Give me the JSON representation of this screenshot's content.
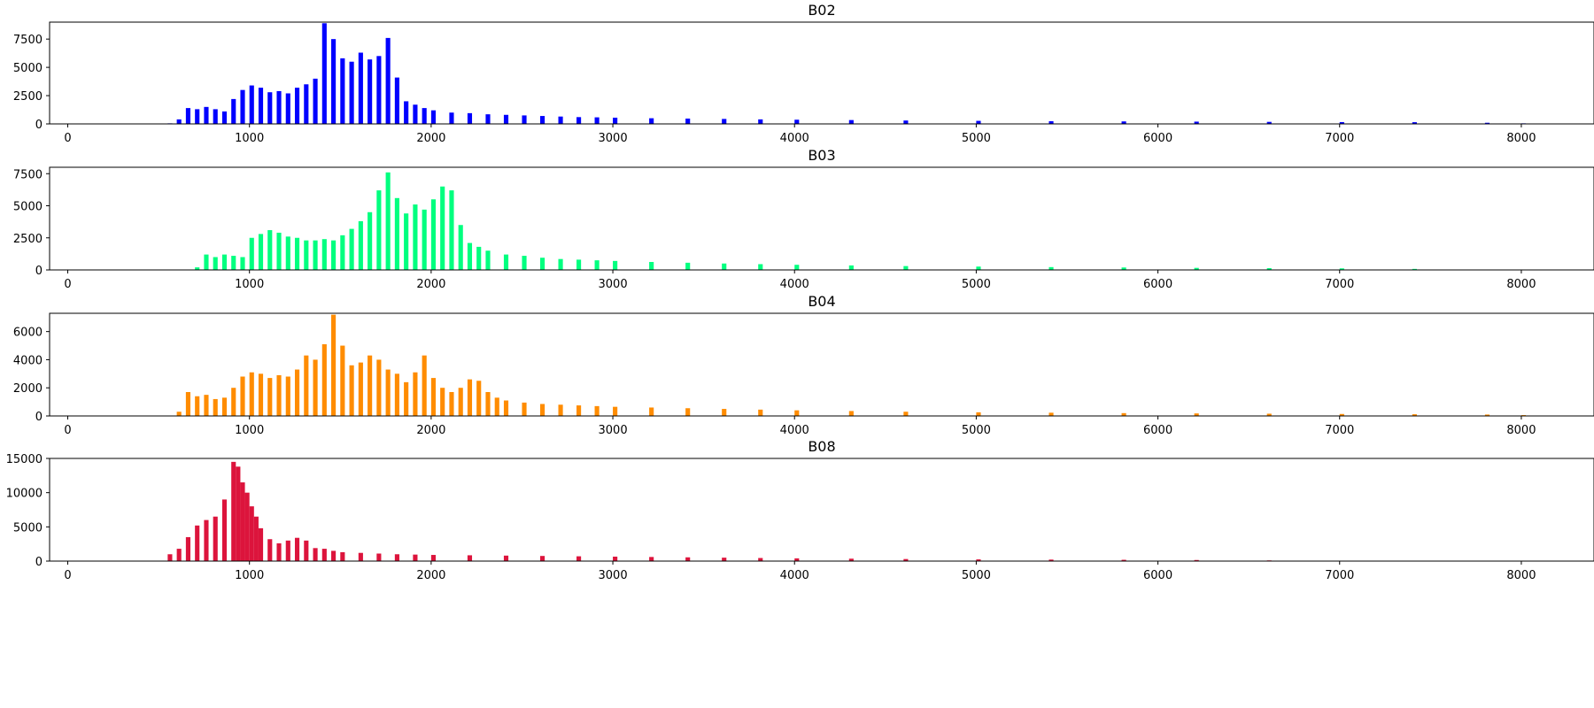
{
  "chart_data": [
    {
      "type": "bar",
      "title": "B02",
      "color": "#0000ff",
      "xlim": [
        -100,
        8400
      ],
      "ylim": [
        0,
        9000
      ],
      "xticks": [
        0,
        1000,
        2000,
        3000,
        4000,
        5000,
        6000,
        7000,
        8000
      ],
      "yticks": [
        0,
        2500,
        5000,
        7500
      ],
      "bin_width": 25,
      "x": [
        550,
        600,
        650,
        700,
        750,
        800,
        850,
        900,
        950,
        1000,
        1050,
        1100,
        1150,
        1200,
        1250,
        1300,
        1350,
        1400,
        1450,
        1500,
        1550,
        1600,
        1650,
        1700,
        1750,
        1800,
        1850,
        1900,
        1950,
        2000,
        2100,
        2200,
        2300,
        2400,
        2500,
        2600,
        2700,
        2800,
        2900,
        3000,
        3200,
        3400,
        3600,
        3800,
        4000,
        4300,
        4600,
        5000,
        5400,
        5800,
        6200,
        6600,
        7000,
        7400,
        7800,
        8000
      ],
      "values": [
        50,
        400,
        1400,
        1300,
        1500,
        1300,
        1100,
        2200,
        3000,
        3400,
        3200,
        2800,
        2900,
        2700,
        3200,
        3500,
        4000,
        8900,
        7500,
        5800,
        5500,
        6300,
        5700,
        6000,
        7600,
        4100,
        2000,
        1700,
        1400,
        1200,
        1000,
        950,
        850,
        800,
        750,
        700,
        650,
        600,
        580,
        550,
        500,
        470,
        440,
        400,
        370,
        340,
        300,
        270,
        240,
        220,
        200,
        180,
        160,
        150,
        100,
        50
      ]
    },
    {
      "type": "bar",
      "title": "B03",
      "color": "#00ff7f",
      "xlim": [
        -100,
        8400
      ],
      "ylim": [
        0,
        8000
      ],
      "xticks": [
        0,
        1000,
        2000,
        3000,
        4000,
        5000,
        6000,
        7000,
        8000
      ],
      "yticks": [
        0,
        2500,
        5000,
        7500
      ],
      "bin_width": 25,
      "x": [
        700,
        750,
        800,
        850,
        900,
        950,
        1000,
        1050,
        1100,
        1150,
        1200,
        1250,
        1300,
        1350,
        1400,
        1450,
        1500,
        1550,
        1600,
        1650,
        1700,
        1750,
        1800,
        1850,
        1900,
        1950,
        2000,
        2050,
        2100,
        2150,
        2200,
        2250,
        2300,
        2400,
        2500,
        2600,
        2700,
        2800,
        2900,
        3000,
        3200,
        3400,
        3600,
        3800,
        4000,
        4300,
        4600,
        5000,
        5400,
        5800,
        6200,
        6600,
        7000,
        7400
      ],
      "values": [
        200,
        1200,
        1000,
        1200,
        1100,
        1000,
        2500,
        2800,
        3100,
        2900,
        2600,
        2500,
        2300,
        2300,
        2400,
        2300,
        2700,
        3200,
        3800,
        4500,
        6200,
        7600,
        5600,
        4400,
        5100,
        4700,
        5500,
        6500,
        6200,
        3500,
        2100,
        1800,
        1500,
        1200,
        1100,
        950,
        850,
        800,
        750,
        700,
        620,
        560,
        500,
        450,
        400,
        350,
        300,
        260,
        220,
        190,
        160,
        140,
        120,
        80
      ]
    },
    {
      "type": "bar",
      "title": "B04",
      "color": "#ff8c00",
      "xlim": [
        -100,
        8400
      ],
      "ylim": [
        0,
        7300
      ],
      "xticks": [
        0,
        1000,
        2000,
        3000,
        4000,
        5000,
        6000,
        7000,
        8000
      ],
      "yticks": [
        0,
        2000,
        4000,
        6000
      ],
      "bin_width": 25,
      "x": [
        600,
        650,
        700,
        750,
        800,
        850,
        900,
        950,
        1000,
        1050,
        1100,
        1150,
        1200,
        1250,
        1300,
        1350,
        1400,
        1450,
        1500,
        1550,
        1600,
        1650,
        1700,
        1750,
        1800,
        1850,
        1900,
        1950,
        2000,
        2050,
        2100,
        2150,
        2200,
        2250,
        2300,
        2350,
        2400,
        2500,
        2600,
        2700,
        2800,
        2900,
        3000,
        3200,
        3400,
        3600,
        3800,
        4000,
        4300,
        4600,
        5000,
        5400,
        5800,
        6200,
        6600,
        7000,
        7400,
        7800,
        8000
      ],
      "values": [
        300,
        1700,
        1400,
        1500,
        1200,
        1300,
        2000,
        2800,
        3100,
        3000,
        2700,
        2900,
        2800,
        3300,
        4300,
        4000,
        5100,
        7200,
        5000,
        3600,
        3800,
        4300,
        4000,
        3300,
        3000,
        2400,
        3100,
        4300,
        2700,
        2000,
        1700,
        2000,
        2600,
        2500,
        1700,
        1300,
        1100,
        950,
        850,
        800,
        750,
        700,
        650,
        600,
        550,
        500,
        450,
        400,
        350,
        300,
        260,
        230,
        200,
        180,
        160,
        140,
        120,
        100,
        60
      ]
    },
    {
      "type": "bar",
      "title": "B08",
      "color": "#dc143c",
      "xlim": [
        -100,
        8400
      ],
      "ylim": [
        0,
        15000
      ],
      "xticks": [
        0,
        1000,
        2000,
        3000,
        4000,
        5000,
        6000,
        7000,
        8000
      ],
      "yticks": [
        0,
        5000,
        10000,
        15000
      ],
      "bin_width": 25,
      "x": [
        550,
        600,
        650,
        700,
        750,
        800,
        850,
        900,
        925,
        950,
        975,
        1000,
        1025,
        1050,
        1100,
        1150,
        1200,
        1250,
        1300,
        1350,
        1400,
        1450,
        1500,
        1600,
        1700,
        1800,
        1900,
        2000,
        2200,
        2400,
        2600,
        2800,
        3000,
        3200,
        3400,
        3600,
        3800,
        4000,
        4300,
        4600,
        5000,
        5400,
        5800,
        6200,
        6600
      ],
      "values": [
        1000,
        1800,
        3500,
        5200,
        6000,
        6500,
        9000,
        14500,
        13800,
        11500,
        10000,
        8000,
        6500,
        4800,
        3200,
        2600,
        3000,
        3400,
        3000,
        1900,
        1800,
        1500,
        1300,
        1200,
        1100,
        1000,
        950,
        900,
        850,
        800,
        750,
        700,
        650,
        600,
        550,
        500,
        450,
        400,
        350,
        300,
        250,
        220,
        190,
        160,
        100
      ]
    }
  ]
}
